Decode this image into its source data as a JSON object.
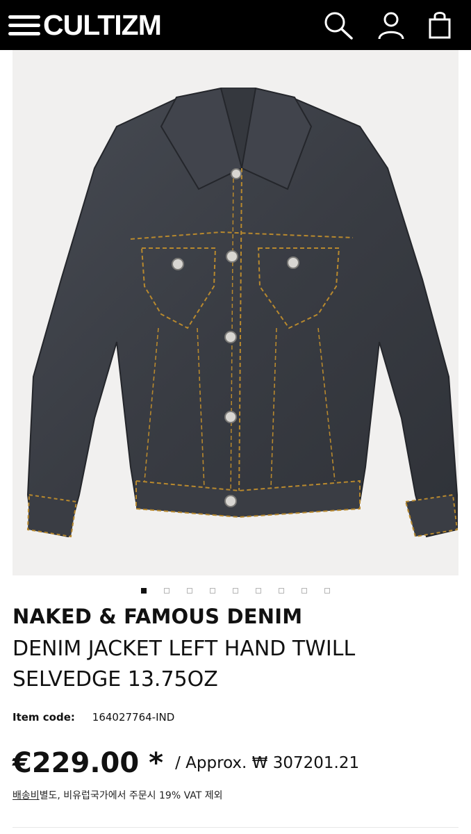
{
  "header": {
    "logo_text": "CULTIZM",
    "icons": [
      "menu-icon",
      "search-icon",
      "account-icon",
      "cart-icon"
    ]
  },
  "product": {
    "image_alt": "denim-jacket-image",
    "brand": "NAKED & FAMOUS DENIM",
    "name": "DENIM JACKET LEFT HAND TWILL SELVEDGE 13.75OZ",
    "item_code_label": "Item code:",
    "item_code": "164027764-IND",
    "price": "€229.00 *",
    "approx_price": "/ Approx. ₩ 307201.21",
    "vat_link": "배송비",
    "vat_note": "별도, 비유럽국가에서 주문시 19% VAT 제외"
  },
  "carousel": {
    "total": 9,
    "active_index": 0
  },
  "colors": {
    "header_bg": "#000000",
    "text": "#111111",
    "image_bg": "#f1f0ef",
    "denim": "#3a3d44",
    "stitch": "#b8892e"
  }
}
